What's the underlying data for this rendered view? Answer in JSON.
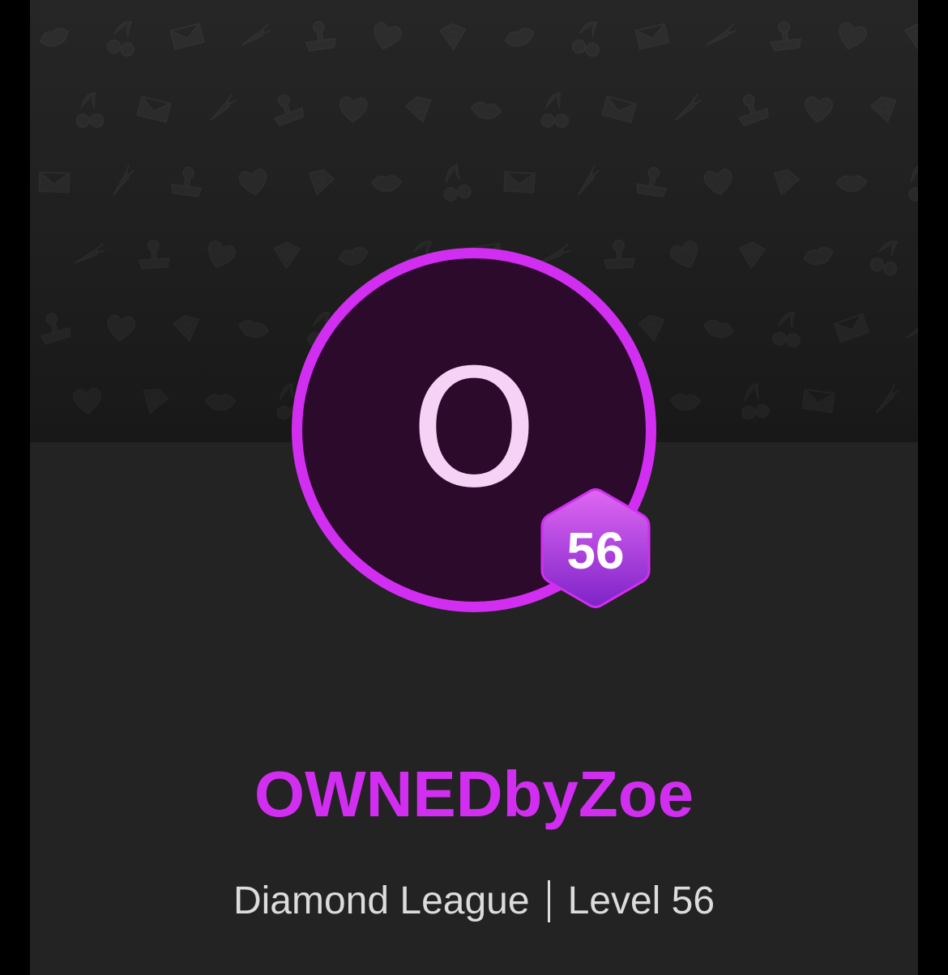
{
  "profile": {
    "avatar_initial": "O",
    "level_badge": "56",
    "username": "OWNEDbyZoe",
    "league": "Diamond League",
    "level_label": "Level 56"
  },
  "cover": {
    "pattern_icons": [
      "lips-icon",
      "cherry-icon",
      "envelope-icon",
      "carrot-icon",
      "joystick-icon",
      "heart-icon",
      "heart-gem-icon"
    ]
  },
  "colors": {
    "accent": "#d22ef2",
    "avatar_fill": "#2b0a2c",
    "initial_text": "#f6d2f7",
    "badge_top": "#e067f3",
    "badge_bottom": "#7e23c8",
    "background": "#232323",
    "secondary_text": "#dcdcdc"
  }
}
